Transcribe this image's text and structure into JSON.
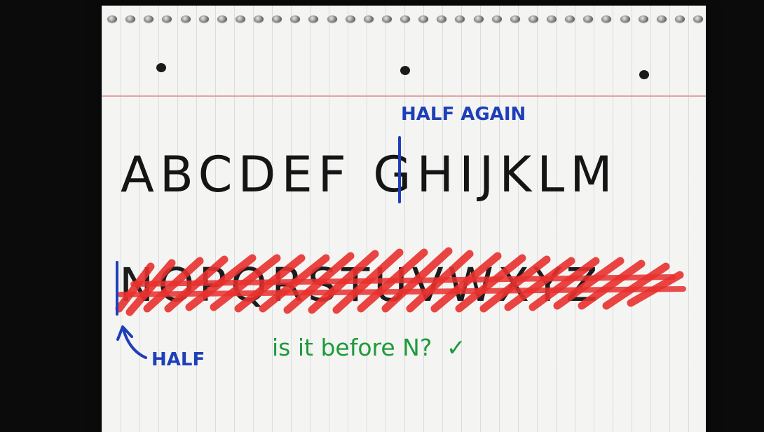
{
  "notepad": {
    "top_row_letters": "ABCDEF GHIJKLM",
    "bottom_row_letters": "NOPQRSTUVWXYZ",
    "half_again_label": "HALF AGAIN",
    "half_label": "HALF",
    "question": "is it before N?",
    "check_mark": "✓"
  },
  "colors": {
    "background": "#0b0b0b",
    "paper": "#f4f4f2",
    "ink_black": "#151515",
    "ink_blue": "#1f3fb8",
    "ink_red": "#e8312e",
    "ink_green": "#1e9a3c"
  }
}
